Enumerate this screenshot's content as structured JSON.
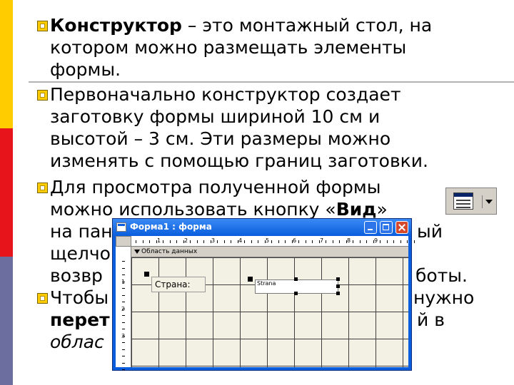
{
  "slide": {
    "bullet1": {
      "bold": "Конструктор",
      "rest": " – это монтажный стол, на",
      "line2": "котором можно размещать элементы",
      "line3": "формы."
    },
    "bullet2": {
      "line1": "Первоначально конструктор создает",
      "line2": "заготовку формы шириной 10 см и",
      "line3": "высотой – 3 см. Эти размеры можно",
      "line4": "изменять с помощью границ заготовки."
    },
    "bullet3": {
      "line1": "Для просмотра полученной формы",
      "line2_pre": "можно использовать кнопку «",
      "line2_bold": "Вид",
      "line2_post": "»",
      "line3": "на пан",
      "line3_right": "ый",
      "line4": "щелчо",
      "line5": "возвр",
      "line5_right": "боты."
    },
    "bullet4": {
      "line1": "Чтобы",
      "line1_right": "нужно",
      "line2_bold": "перет",
      "line2_right": "й в",
      "line3_italic": "облас"
    }
  },
  "view_button": {
    "icon": "form-view-icon",
    "arrow": "dropdown-arrow-icon"
  },
  "form_window": {
    "title": "Форма1 : форма",
    "section_label": "Область данных",
    "ruler_numbers": [
      "1",
      "2",
      "3",
      "4",
      "5",
      "6",
      "7",
      "8",
      "9"
    ],
    "vruler_numbers": [
      "1",
      "2",
      "3"
    ],
    "label_text": "Страна:",
    "textbox_text": "Strana"
  },
  "colors": {
    "accent_yellow": "#FFCC00",
    "accent_red": "#E8141B",
    "accent_purple": "#6B6E9F",
    "titlebar_blue": "#0a5ddc"
  }
}
